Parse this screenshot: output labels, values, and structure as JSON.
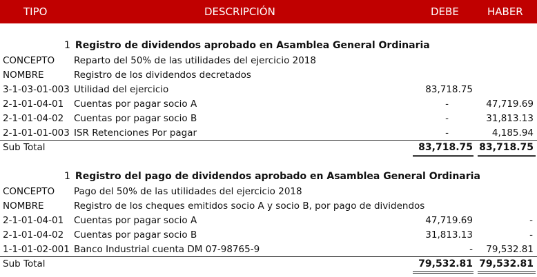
{
  "header": {
    "tipo": "TIPO",
    "descripcion": "DESCRIPCIÓN",
    "debe": "DEBE",
    "haber": "HABER"
  },
  "colors": {
    "header_bg": "#c00000",
    "header_text": "#ffffff"
  },
  "entries": [
    {
      "number": "1",
      "title": "Registro de dividendos aprobado en Asamblea General Ordinaria",
      "concepto_label": "CONCEPTO",
      "concepto": "Reparto del 50% de las utilidades del ejercicio 2018",
      "nombre_label": "NOMBRE",
      "nombre": "Registro de los dividendos decretados",
      "lines": [
        {
          "code": "3-1-03-01-003",
          "desc": "Utilidad del ejercicio",
          "debe": "83,718.75",
          "haber": ""
        },
        {
          "code": "2-1-01-04-01",
          "desc": "Cuentas por pagar socio A",
          "debe": "-",
          "haber": "47,719.69"
        },
        {
          "code": "2-1-01-04-02",
          "desc": "Cuentas por pagar socio B",
          "debe": "-",
          "haber": "31,813.13"
        },
        {
          "code": "2-1-01-01-003",
          "desc": "ISR Retenciones Por pagar",
          "debe": "-",
          "haber": "4,185.94"
        }
      ],
      "subtotal_label": "Sub Total",
      "subtotal_debe": "83,718.75",
      "subtotal_haber": "83,718.75"
    },
    {
      "number": "1",
      "title": "Registro del pago de dividendos aprobado en Asamblea General Ordinaria",
      "concepto_label": "CONCEPTO",
      "concepto": "Pago del 50% de las utilidades del ejercicio 2018",
      "nombre_label": "NOMBRE",
      "nombre": "Registro de los cheques emitidos socio A y socio B, por pago de dividendos",
      "lines": [
        {
          "code": "2-1-01-04-01",
          "desc": "Cuentas por pagar socio A",
          "debe": "47,719.69",
          "haber": "-"
        },
        {
          "code": "2-1-01-04-02",
          "desc": "Cuentas por pagar socio B",
          "debe": "31,813.13",
          "haber": "-"
        },
        {
          "code": "1-1-01-02-001",
          "desc": "Banco Industrial cuenta DM 07-98765-9",
          "debe": "-",
          "haber": "79,532.81"
        }
      ],
      "subtotal_label": "Sub Total",
      "subtotal_debe": "79,532.81",
      "subtotal_haber": "79,532.81"
    }
  ]
}
